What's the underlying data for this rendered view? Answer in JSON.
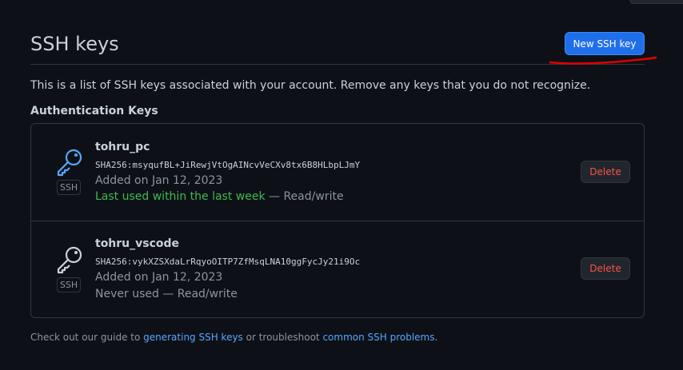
{
  "header": {
    "title": "SSH keys",
    "new_key_label": "New SSH key"
  },
  "intro": "This is a list of SSH keys associated with your account. Remove any keys that you do not recognize.",
  "section_title": "Authentication Keys",
  "keys": [
    {
      "title": "tohru_pc",
      "badge": "SSH",
      "fingerprint": "SHA256:msyqufBL+JiRewjVtOgAINcvVeCXv8tx6B8HLbpLJmY",
      "added": "Added on Jan 12, 2023",
      "usage_highlight": "Last used within the last week",
      "usage_rest": " — Read/write",
      "delete_label": "Delete"
    },
    {
      "title": "tohru_vscode",
      "badge": "SSH",
      "fingerprint": "SHA256:vykXZSXdaLrRqyoOITP7ZfMsqLNA10ggFycJy21i9Oc",
      "added": "Added on Jan 12, 2023",
      "usage": "Never used — Read/write",
      "delete_label": "Delete"
    }
  ],
  "footer": {
    "prefix": "Check out our guide to ",
    "link1": "generating SSH keys",
    "middle": " or troubleshoot ",
    "link2": "common SSH problems",
    "suffix": "."
  },
  "colors": {
    "background": "#0d1117",
    "accent_blue": "#1f6feb",
    "link": "#58a6ff",
    "danger": "#f85149",
    "success": "#3fb950",
    "annotation": "#e00000"
  },
  "icons": [
    "key-icon",
    "key-icon"
  ]
}
